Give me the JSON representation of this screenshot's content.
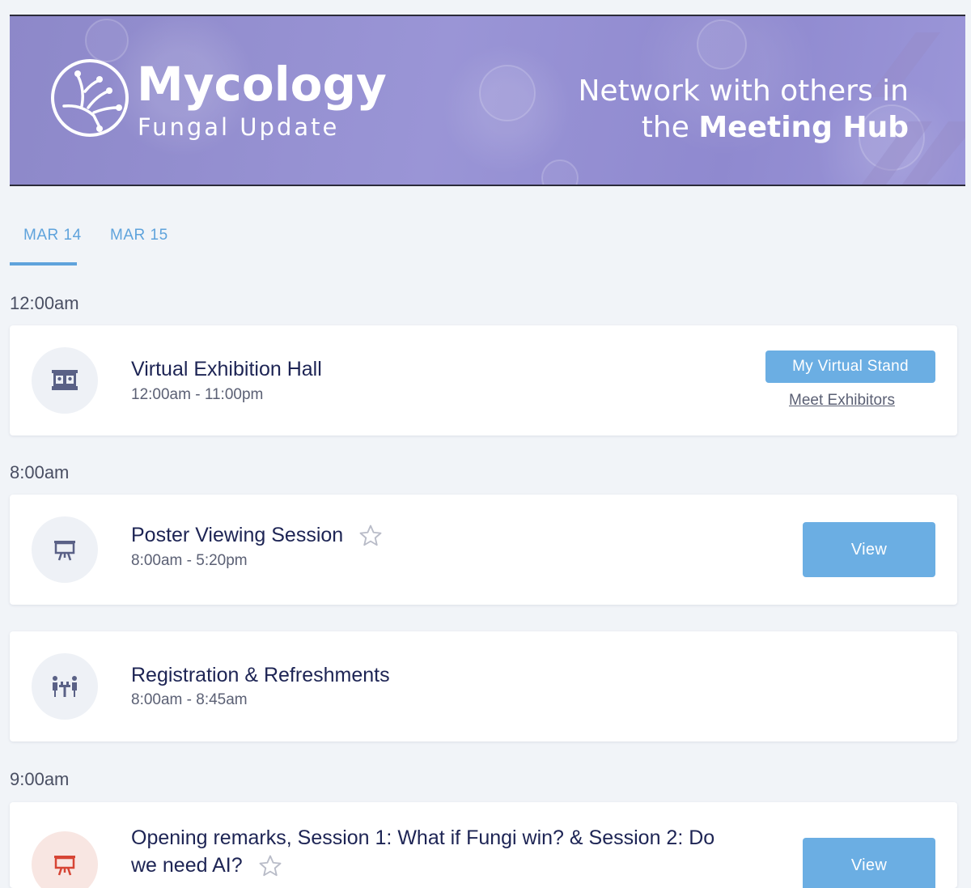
{
  "banner": {
    "title": "Mycology",
    "subtitle": "Fungal Update",
    "tagline_line1": "Network with others in",
    "tagline_prefix": "the",
    "tagline_bold": "Meeting Hub"
  },
  "tabs": [
    {
      "label": "MAR 14",
      "active": true
    },
    {
      "label": "MAR 15",
      "active": false
    }
  ],
  "schedule": {
    "time_1200": "12:00am",
    "time_800": "8:00am",
    "time_900": "9:00am",
    "exhibition": {
      "title": "Virtual Exhibition Hall",
      "time": "12:00am - 11:00pm",
      "primary_button": "My Virtual Stand",
      "link": "Meet Exhibitors",
      "icon": "exhibition-hall-icon"
    },
    "poster": {
      "title": "Poster Viewing Session",
      "time": "8:00am - 5:20pm",
      "button": "View",
      "icon": "presentation-board-icon"
    },
    "registration": {
      "title": "Registration & Refreshments",
      "time": "8:00am - 8:45am",
      "icon": "networking-people-icon"
    },
    "opening": {
      "title_line1": "Opening remarks, Session 1: What if Fungi win? & Session 2: Do",
      "title_line2": "we need AI?",
      "button": "View",
      "icon": "presentation-board-icon"
    }
  },
  "colors": {
    "accent": "#6baee3",
    "tab_active": "#5fa3dc",
    "title_text": "#1d2454",
    "icon_red": "#d64535",
    "page_bg": "#f1f4f8"
  }
}
